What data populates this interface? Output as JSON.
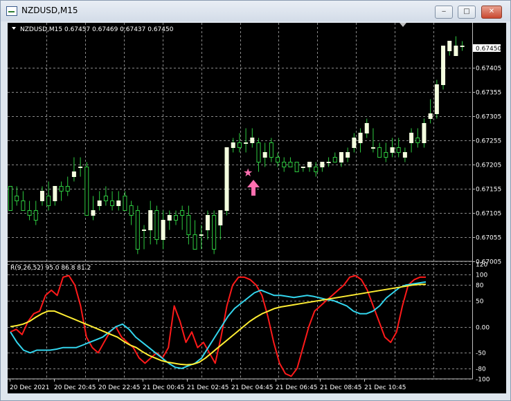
{
  "window": {
    "title": "NZDUSD,M15",
    "minimize_icon": "minimize-icon",
    "maximize_icon": "maximize-icon",
    "close_icon": "close-icon"
  },
  "main_panel": {
    "header": "NZDUSD,M15  0.67457 0.67469 0.67437 0.67450",
    "current_price": "0.67450",
    "price_ticks": [
      "0.67405",
      "0.67355",
      "0.67305",
      "0.67255",
      "0.67205",
      "0.67155",
      "0.67105",
      "0.67055",
      "0.67005"
    ]
  },
  "indicator_panel": {
    "header": "R(9,26,52) 95.0 86.8 81.2",
    "scale_ticks": [
      "120",
      "100",
      "80",
      "50",
      "0.00",
      "-50",
      "-80",
      "-100"
    ]
  },
  "time_axis": [
    "20 Dec 2021",
    "20 Dec 20:45",
    "20 Dec 22:45",
    "21 Dec 00:45",
    "21 Dec 02:45",
    "21 Dec 04:45",
    "21 Dec 06:45",
    "21 Dec 08:45",
    "21 Dec 10:45"
  ],
  "markers": {
    "star": "★",
    "arrow_up": "up-arrow-icon"
  },
  "colors": {
    "background": "#000000",
    "grid": "#8a8a8a",
    "bull_candle": "#f4ffdf",
    "wick": "#2ecc40",
    "line_red": "#ff1a1a",
    "line_cyan": "#33d6ee",
    "line_yellow": "#ffee33",
    "marker": "#ff6fb0"
  },
  "chart_data": [
    {
      "type": "candlestick",
      "symbol": "NZDUSD",
      "timeframe": "M15",
      "ylim": [
        0.67005,
        0.67475
      ],
      "ohlc": [
        [
          0.6716,
          0.6716,
          0.6711,
          0.6711
        ],
        [
          0.6714,
          0.6716,
          0.6712,
          0.6713
        ],
        [
          0.6713,
          0.6715,
          0.6711,
          0.6711
        ],
        [
          0.6711,
          0.6713,
          0.6709,
          0.671
        ],
        [
          0.6711,
          0.6713,
          0.6708,
          0.6709
        ],
        [
          0.6713,
          0.6716,
          0.6712,
          0.6715
        ],
        [
          0.6714,
          0.6717,
          0.6711,
          0.6712
        ],
        [
          0.6713,
          0.6716,
          0.6712,
          0.6716
        ],
        [
          0.6716,
          0.6717,
          0.6713,
          0.6715
        ],
        [
          0.6716,
          0.6718,
          0.6714,
          0.6715
        ],
        [
          0.6718,
          0.6722,
          0.6717,
          0.6719
        ],
        [
          0.672,
          0.6722,
          0.6718,
          0.672
        ],
        [
          0.672,
          0.6721,
          0.671,
          0.671
        ],
        [
          0.671,
          0.6714,
          0.6709,
          0.6711
        ],
        [
          0.6712,
          0.6715,
          0.6711,
          0.6713
        ],
        [
          0.6714,
          0.6716,
          0.6712,
          0.6713
        ],
        [
          0.6713,
          0.6715,
          0.6711,
          0.6712
        ],
        [
          0.6712,
          0.6715,
          0.6711,
          0.6713
        ],
        [
          0.6714,
          0.6715,
          0.6711,
          0.6711
        ],
        [
          0.6712,
          0.6713,
          0.6708,
          0.671
        ],
        [
          0.6711,
          0.6712,
          0.6702,
          0.6703
        ],
        [
          0.6707,
          0.6708,
          0.6703,
          0.6707
        ],
        [
          0.6707,
          0.6713,
          0.6704,
          0.6711
        ],
        [
          0.6711,
          0.6712,
          0.6704,
          0.6705
        ],
        [
          0.6705,
          0.6711,
          0.6703,
          0.6709
        ],
        [
          0.6709,
          0.6711,
          0.6707,
          0.671
        ],
        [
          0.671,
          0.6711,
          0.6708,
          0.6709
        ],
        [
          0.6711,
          0.6712,
          0.6707,
          0.671
        ],
        [
          0.671,
          0.6712,
          0.6704,
          0.6706
        ],
        [
          0.6706,
          0.6709,
          0.6703,
          0.6703
        ],
        [
          0.6706,
          0.6708,
          0.6703,
          0.6706
        ],
        [
          0.6707,
          0.6711,
          0.6705,
          0.671
        ],
        [
          0.671,
          0.6711,
          0.6702,
          0.6703
        ],
        [
          0.6708,
          0.6711,
          0.6705,
          0.6711
        ],
        [
          0.6711,
          0.6724,
          0.671,
          0.6724
        ],
        [
          0.6724,
          0.6726,
          0.6723,
          0.6725
        ],
        [
          0.6725,
          0.6727,
          0.6723,
          0.6724
        ],
        [
          0.6725,
          0.6728,
          0.6723,
          0.6725
        ],
        [
          0.6725,
          0.6728,
          0.6724,
          0.6726
        ],
        [
          0.6725,
          0.6726,
          0.6719,
          0.6721
        ],
        [
          0.6722,
          0.6725,
          0.672,
          0.6723
        ],
        [
          0.6725,
          0.6726,
          0.6721,
          0.6722
        ],
        [
          0.6722,
          0.6723,
          0.672,
          0.6721
        ],
        [
          0.6721,
          0.6722,
          0.6719,
          0.672
        ],
        [
          0.6721,
          0.6722,
          0.672,
          0.672
        ],
        [
          0.6721,
          0.6721,
          0.6719,
          0.6719
        ],
        [
          0.672,
          0.672,
          0.6719,
          0.672
        ],
        [
          0.672,
          0.6721,
          0.6719,
          0.6721
        ],
        [
          0.672,
          0.6721,
          0.6718,
          0.6719
        ],
        [
          0.672,
          0.6721,
          0.6719,
          0.6721
        ],
        [
          0.6721,
          0.6722,
          0.672,
          0.6721
        ],
        [
          0.6722,
          0.6723,
          0.6721,
          0.6721
        ],
        [
          0.6721,
          0.6723,
          0.672,
          0.6723
        ],
        [
          0.6722,
          0.6724,
          0.6721,
          0.6723
        ],
        [
          0.6724,
          0.6727,
          0.6723,
          0.6726
        ],
        [
          0.6725,
          0.6728,
          0.6723,
          0.6727
        ],
        [
          0.6727,
          0.673,
          0.6726,
          0.6729
        ],
        [
          0.6724,
          0.6728,
          0.6723,
          0.6724
        ],
        [
          0.6724,
          0.6725,
          0.6722,
          0.6722
        ],
        [
          0.6723,
          0.6725,
          0.6721,
          0.6722
        ],
        [
          0.6723,
          0.6726,
          0.6722,
          0.6724
        ],
        [
          0.6724,
          0.6726,
          0.6722,
          0.6723
        ],
        [
          0.6722,
          0.6724,
          0.6721,
          0.6723
        ],
        [
          0.6725,
          0.6728,
          0.6723,
          0.6727
        ],
        [
          0.6726,
          0.6728,
          0.6724,
          0.6725
        ],
        [
          0.6725,
          0.673,
          0.6724,
          0.6729
        ],
        [
          0.673,
          0.6734,
          0.6729,
          0.6731
        ],
        [
          0.6731,
          0.6738,
          0.673,
          0.6737
        ],
        [
          0.6737,
          0.6745,
          0.6736,
          0.6745
        ],
        [
          0.6744,
          0.6746,
          0.6743,
          0.6746
        ],
        [
          0.6743,
          0.6747,
          0.6743,
          0.6745
        ],
        [
          0.6745,
          0.6746,
          0.6744,
          0.6745
        ]
      ]
    },
    {
      "type": "line",
      "ylim": [
        -100,
        120
      ],
      "series": [
        {
          "color": "red",
          "values": [
            -10,
            -5,
            -15,
            10,
            25,
            30,
            60,
            70,
            60,
            95,
            98,
            80,
            40,
            -20,
            -40,
            -50,
            -30,
            -10,
            0,
            -20,
            -30,
            -40,
            -60,
            -70,
            -60,
            -50,
            -60,
            -40,
            40,
            10,
            -30,
            -10,
            -40,
            -30,
            -50,
            -70,
            -20,
            40,
            80,
            95,
            95,
            90,
            80,
            60,
            20,
            -30,
            -70,
            -90,
            -95,
            -80,
            -40,
            0,
            30,
            40,
            50,
            60,
            70,
            80,
            95,
            98,
            90,
            70,
            40,
            10,
            -20,
            -30,
            -10,
            40,
            80,
            90,
            95,
            95
          ]
        },
        {
          "color": "cyan",
          "values": [
            -10,
            -30,
            -45,
            -50,
            -45,
            -45,
            -45,
            -43,
            -40,
            -40,
            -40,
            -35,
            -30,
            -25,
            -20,
            -10,
            0,
            5,
            -5,
            -20,
            -30,
            -40,
            -50,
            -60,
            -70,
            -78,
            -80,
            -75,
            -70,
            -60,
            -40,
            -20,
            0,
            20,
            35,
            45,
            55,
            65,
            70,
            65,
            60,
            60,
            58,
            56,
            58,
            60,
            58,
            55,
            52,
            50,
            45,
            40,
            30,
            25,
            25,
            30,
            40,
            55,
            65,
            75,
            80,
            82,
            84,
            86
          ]
        },
        {
          "color": "yellow",
          "values": [
            0,
            2,
            5,
            10,
            18,
            25,
            30,
            30,
            25,
            20,
            15,
            10,
            5,
            0,
            -5,
            -10,
            -15,
            -20,
            -28,
            -35,
            -40,
            -48,
            -55,
            -60,
            -65,
            -68,
            -70,
            -72,
            -73,
            -72,
            -68,
            -60,
            -50,
            -40,
            -30,
            -20,
            -10,
            0,
            10,
            18,
            25,
            30,
            35,
            38,
            40,
            42,
            44,
            46,
            48,
            50,
            52,
            54,
            56,
            58,
            60,
            62,
            64,
            66,
            68,
            70,
            72,
            74,
            76,
            78,
            80,
            81,
            81.2
          ]
        }
      ]
    }
  ]
}
